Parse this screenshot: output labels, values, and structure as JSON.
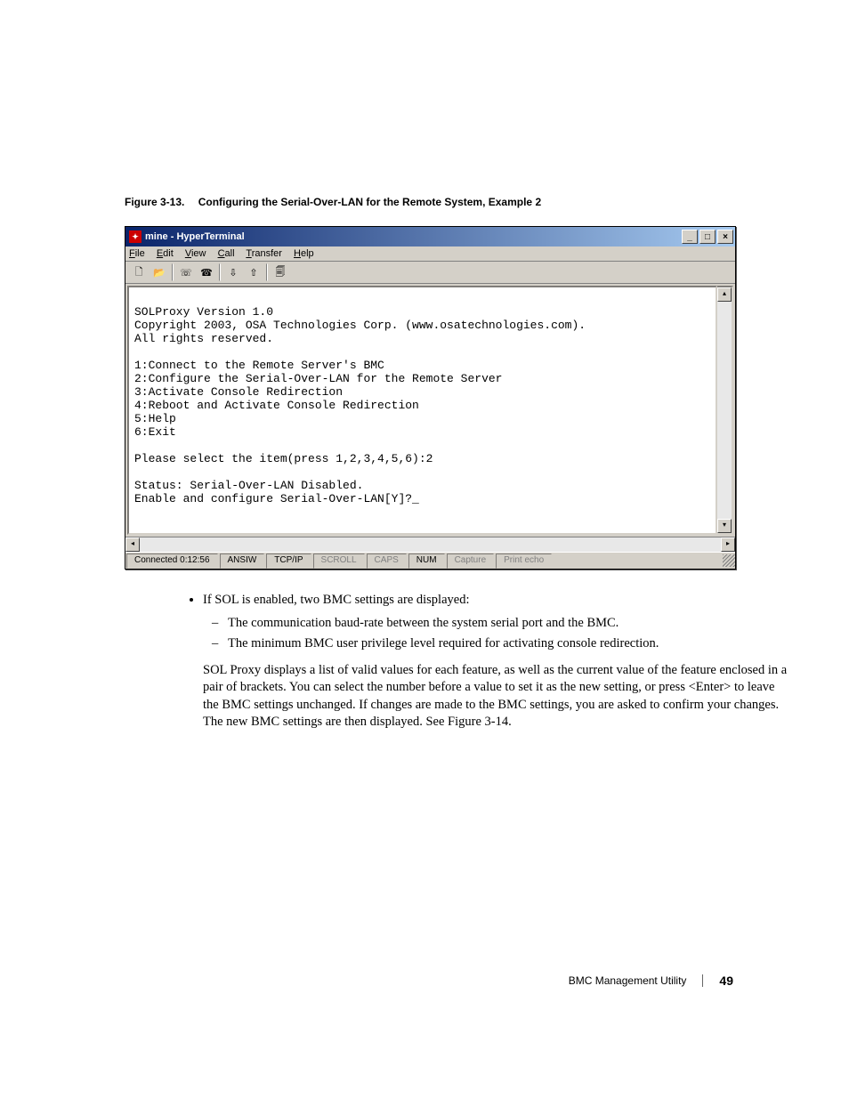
{
  "figure": {
    "label": "Figure 3-13.",
    "title": "Configuring the Serial-Over-LAN for the Remote System, Example 2"
  },
  "window": {
    "title": "mine - HyperTerminal",
    "menus": [
      "File",
      "Edit",
      "View",
      "Call",
      "Transfer",
      "Help"
    ],
    "toolbar_icons": [
      "new-file-icon",
      "open-icon",
      "connect-icon",
      "disconnect-icon",
      "send-icon",
      "receive-icon",
      "properties-icon"
    ]
  },
  "terminal": {
    "lines": [
      "SOLProxy Version 1.0",
      "Copyright 2003, OSA Technologies Corp. (www.osatechnologies.com).",
      "All rights reserved.",
      "",
      "1:Connect to the Remote Server's BMC",
      "2:Configure the Serial-Over-LAN for the Remote Server",
      "3:Activate Console Redirection",
      "4:Reboot and Activate Console Redirection",
      "5:Help",
      "6:Exit",
      "",
      "Please select the item(press 1,2,3,4,5,6):2",
      "",
      "Status: Serial-Over-LAN Disabled.",
      "Enable and configure Serial-Over-LAN[Y]?_"
    ]
  },
  "statusbar": {
    "connected": "Connected 0:12:56",
    "emulation": "ANSIW",
    "protocol": "TCP/IP",
    "scroll": "SCROLL",
    "caps": "CAPS",
    "num": "NUM",
    "capture": "Capture",
    "printecho": "Print echo"
  },
  "body": {
    "bullet1": "If SOL is enabled, two BMC settings are displayed:",
    "sub1": "The communication baud-rate between the system serial port and the BMC.",
    "sub2": "The minimum BMC user privilege level required for activating console redirection.",
    "para": "SOL Proxy displays a list of valid values for each feature, as well as the current value of the feature enclosed in a pair of brackets. You can select the number before a value to set it as the new setting, or press <Enter> to leave the BMC settings unchanged. If changes are made to the BMC settings, you are asked to confirm your changes. The new BMC settings are then displayed. See Figure 3-14."
  },
  "footer": {
    "section": "BMC Management Utility",
    "page": "49"
  }
}
